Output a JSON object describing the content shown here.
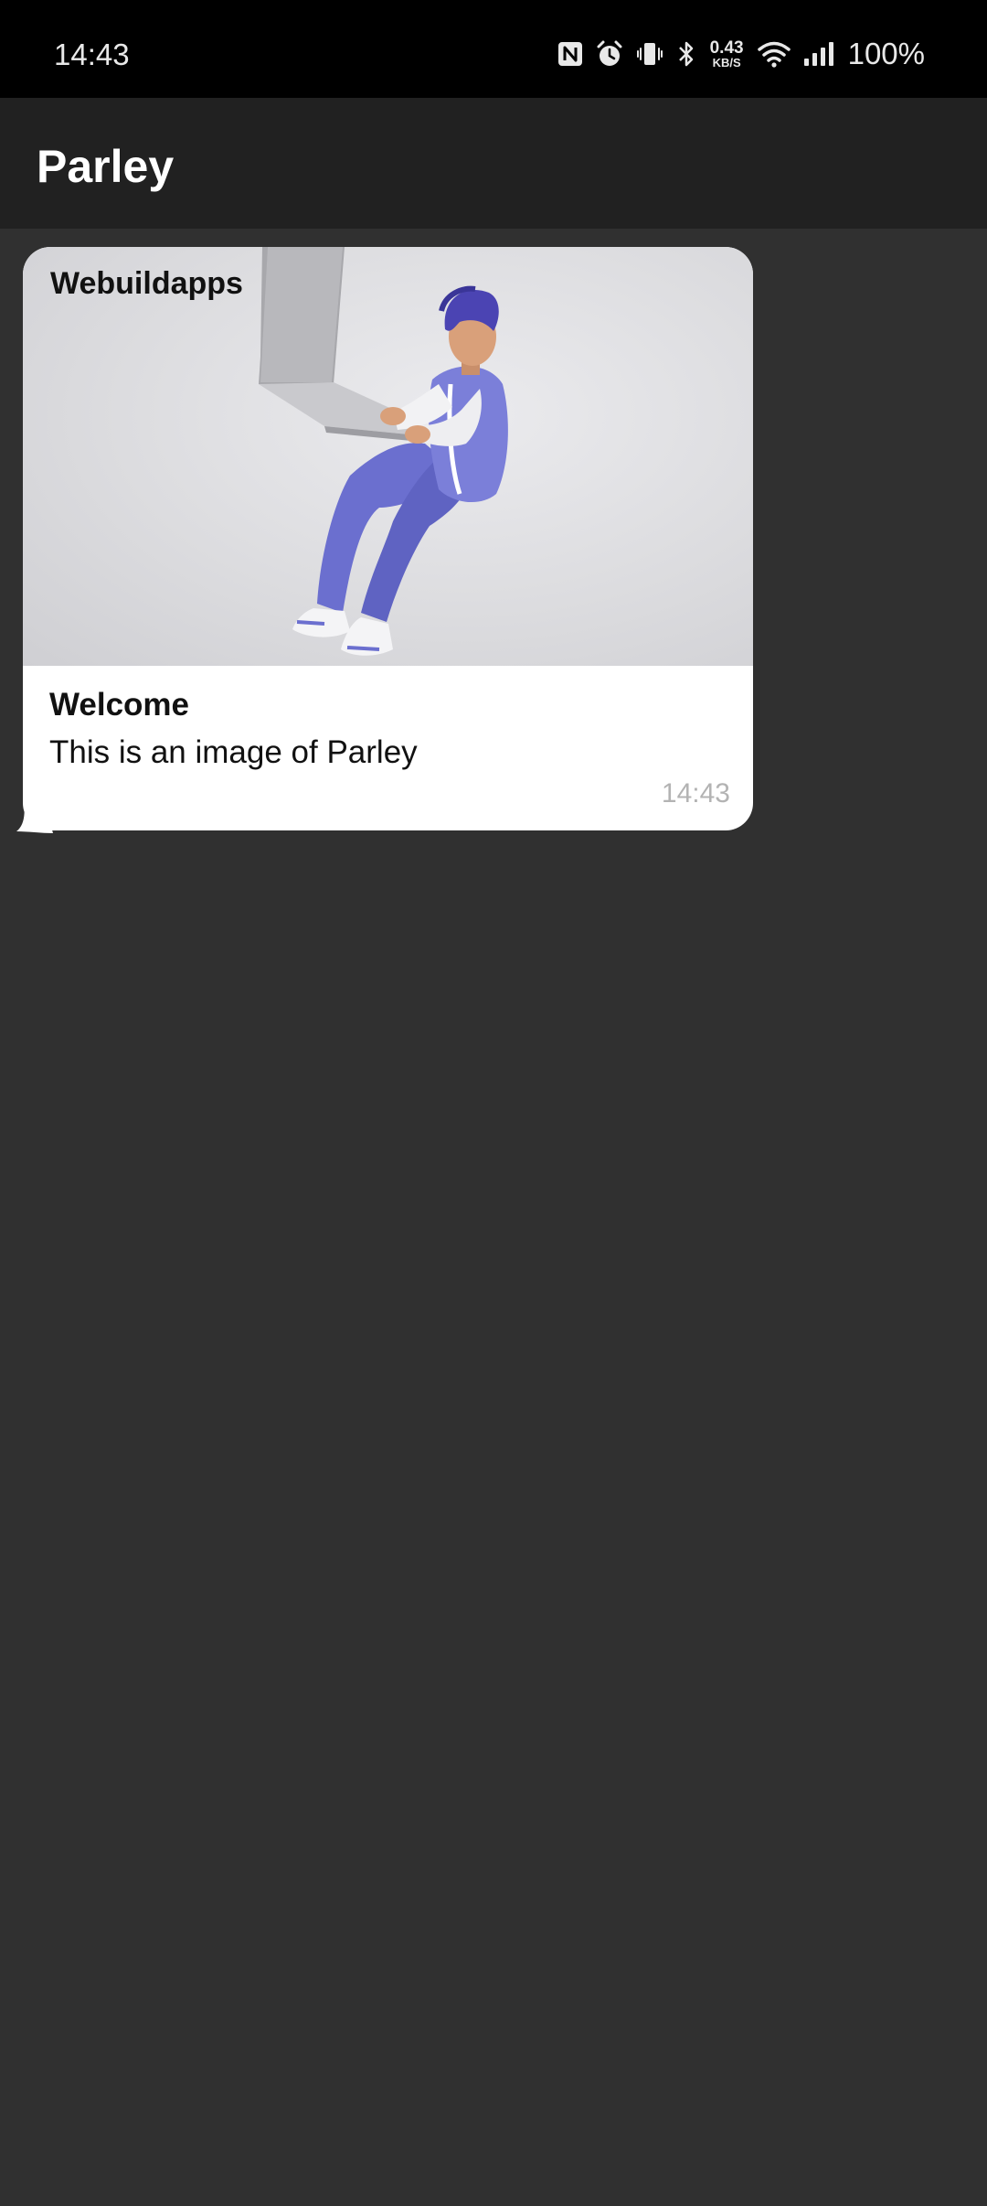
{
  "status_bar": {
    "time": "14:43",
    "net_speed_value": "0.43",
    "net_speed_unit": "KB/S",
    "battery": "100%",
    "icons": [
      "nfc-icon",
      "alarm-icon",
      "vibrate-icon",
      "bluetooth-icon",
      "wifi-icon",
      "signal-icon"
    ]
  },
  "app_bar": {
    "title": "Parley"
  },
  "messages": [
    {
      "media_caption": "Webuildapps",
      "title": "Welcome",
      "body": "This is an image of Parley",
      "time": "14:43"
    }
  ],
  "colors": {
    "status_bar_bg": "#000000",
    "app_bar_bg": "#212121",
    "chat_bg": "#303030",
    "bubble_bg": "#ffffff",
    "timestamp": "#b3b3b3",
    "illustration_accent": "#6b6fcf"
  }
}
